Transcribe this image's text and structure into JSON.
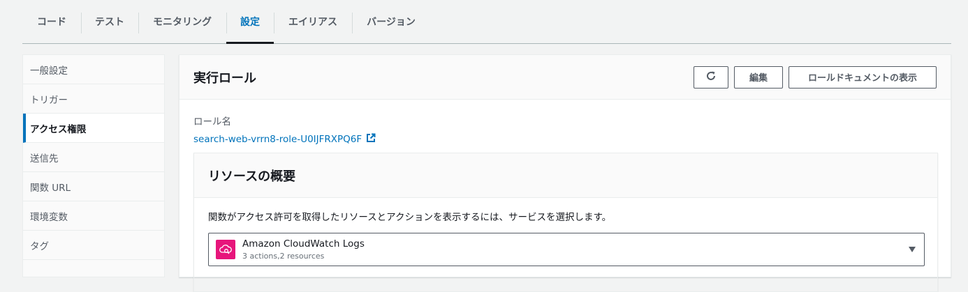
{
  "tabs": [
    {
      "label": "コード"
    },
    {
      "label": "テスト"
    },
    {
      "label": "モニタリング"
    },
    {
      "label": "設定"
    },
    {
      "label": "エイリアス"
    },
    {
      "label": "バージョン"
    }
  ],
  "active_tab": "設定",
  "sidenav": {
    "items": [
      {
        "label": "一般設定"
      },
      {
        "label": "トリガー"
      },
      {
        "label": "アクセス権限"
      },
      {
        "label": "送信先"
      },
      {
        "label": "関数 URL"
      },
      {
        "label": "環境変数"
      },
      {
        "label": "タグ"
      }
    ],
    "active": "アクセス権限"
  },
  "execution_role": {
    "title": "実行ロール",
    "refresh_icon": "refresh-icon",
    "edit_label": "編集",
    "view_document_label": "ロールドキュメントの表示",
    "role_name_label": "ロール名",
    "role_name": "search-web-vrrn8-role-U0IJFRXPQ6F",
    "external_link_icon": "external-link-icon"
  },
  "resource_summary": {
    "title": "リソースの概要",
    "description": "関数がアクセス許可を取得したリソースとアクションを表示するには、サービスを選択します。",
    "selected_service": {
      "name": "Amazon CloudWatch Logs",
      "meta": "3 actions,2 resources",
      "icon": "cloudwatch-logs-icon",
      "icon_color": "#e7157b"
    }
  },
  "colors": {
    "accent": "#0073bb",
    "text": "#16191f",
    "muted": "#545b64",
    "background": "#f2f3f3"
  }
}
